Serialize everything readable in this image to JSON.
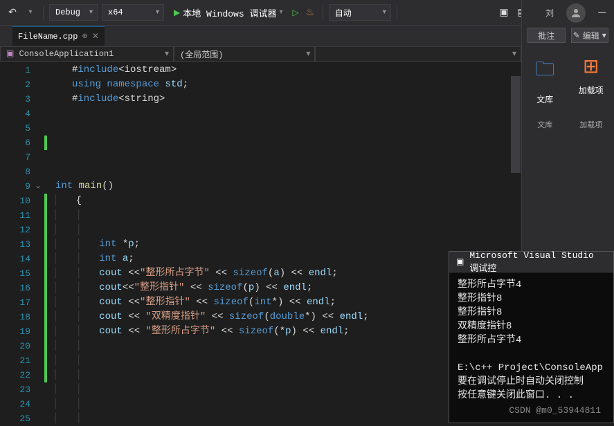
{
  "toolbar": {
    "config": "Debug",
    "platform": "x64",
    "debug_label": "本地 Windows 调试器",
    "auto_label": "自动"
  },
  "tab": {
    "filename": "FileName.cpp"
  },
  "scope": {
    "project": "ConsoleApplication1",
    "scope_label": "(全局范围)"
  },
  "editor": {
    "line_count": 25,
    "fold_line": 9,
    "lines": [
      {
        "n": 1,
        "diff": false,
        "html": "<span class='op'>#</span><span class='kw'>include</span><span class='punct'>&lt;</span><span class='plain'>iostream</span><span class='punct'>&gt;</span>"
      },
      {
        "n": 2,
        "diff": false,
        "html": "<span class='kw'>using</span> <span class='kw'>namespace</span> <span class='ident'>std</span><span class='punct'>;</span>"
      },
      {
        "n": 3,
        "diff": false,
        "html": "<span class='op'>#</span><span class='kw'>include</span><span class='punct'>&lt;</span><span class='plain'>string</span><span class='punct'>&gt;</span>"
      },
      {
        "n": 4,
        "diff": false,
        "html": ""
      },
      {
        "n": 5,
        "diff": false,
        "html": ""
      },
      {
        "n": 6,
        "diff": true,
        "html": ""
      },
      {
        "n": 7,
        "diff": false,
        "html": ""
      },
      {
        "n": 8,
        "diff": false,
        "html": ""
      },
      {
        "n": 9,
        "diff": false,
        "html": "<span class='type'>int</span> <span class='func'>main</span><span class='punct'>()</span>"
      },
      {
        "n": 10,
        "diff": true,
        "indent": 0,
        "html": "<span class='punct'>{</span>"
      },
      {
        "n": 11,
        "diff": true,
        "indent": 1,
        "html": ""
      },
      {
        "n": 12,
        "diff": true,
        "indent": 1,
        "html": ""
      },
      {
        "n": 13,
        "diff": true,
        "indent": 1,
        "html": "<span class='type'>int</span> <span class='op'>*</span><span class='ident'>p</span><span class='punct'>;</span>"
      },
      {
        "n": 14,
        "diff": true,
        "indent": 1,
        "html": "<span class='type'>int</span> <span class='ident'>a</span><span class='punct'>;</span>"
      },
      {
        "n": 15,
        "diff": true,
        "indent": 1,
        "html": "<span class='ident'>cout</span> <span class='op'>&lt;&lt;</span><span class='str'>\"整形所占字节\"</span> <span class='op'>&lt;&lt;</span> <span class='kw'>sizeof</span><span class='punct'>(</span><span class='ident'>a</span><span class='punct'>)</span> <span class='op'>&lt;&lt;</span> <span class='ident'>endl</span><span class='punct'>;</span>"
      },
      {
        "n": 16,
        "diff": true,
        "indent": 1,
        "html": "<span class='ident'>cout</span><span class='op'>&lt;&lt;</span><span class='str'>\"整形指针\"</span> <span class='op'>&lt;&lt;</span> <span class='kw'>sizeof</span><span class='punct'>(</span><span class='ident'>p</span><span class='punct'>)</span> <span class='op'>&lt;&lt;</span> <span class='ident'>endl</span><span class='punct'>;</span>"
      },
      {
        "n": 17,
        "diff": true,
        "indent": 1,
        "html": "<span class='ident'>cout</span> <span class='op'>&lt;&lt;</span><span class='str'>\"整形指针\"</span> <span class='op'>&lt;&lt;</span> <span class='kw'>sizeof</span><span class='punct'>(</span><span class='type'>int</span><span class='op'>*</span><span class='punct'>)</span> <span class='op'>&lt;&lt;</span> <span class='ident'>endl</span><span class='punct'>;</span>"
      },
      {
        "n": 18,
        "diff": true,
        "indent": 1,
        "html": "<span class='ident'>cout</span> <span class='op'>&lt;&lt;</span> <span class='str'>\"双精度指针\"</span> <span class='op'>&lt;&lt;</span> <span class='kw'>sizeof</span><span class='punct'>(</span><span class='type'>double</span><span class='op'>*</span><span class='punct'>)</span> <span class='op'>&lt;&lt;</span> <span class='ident'>endl</span><span class='punct'>;</span>"
      },
      {
        "n": 19,
        "diff": true,
        "indent": 1,
        "html": "<span class='ident'>cout</span> <span class='op'>&lt;&lt;</span> <span class='str'>\"整形所占字节\"</span> <span class='op'>&lt;&lt;</span> <span class='kw'>sizeof</span><span class='punct'>(</span><span class='op'>*</span><span class='ident'>p</span><span class='punct'>)</span> <span class='op'>&lt;&lt;</span> <span class='ident'>endl</span><span class='punct'>;</span>"
      },
      {
        "n": 20,
        "diff": true,
        "indent": 1,
        "html": ""
      },
      {
        "n": 21,
        "diff": true,
        "indent": 1,
        "html": ""
      },
      {
        "n": 22,
        "diff": true,
        "indent": 1,
        "html": ""
      },
      {
        "n": 23,
        "diff": false,
        "indent": 1,
        "html": ""
      },
      {
        "n": 24,
        "diff": false,
        "indent": 1,
        "html": ""
      },
      {
        "n": 25,
        "diff": false,
        "indent": 1,
        "html": ""
      }
    ]
  },
  "right_panel": {
    "user_char": "刘",
    "annotate": "批注",
    "edit": "编辑",
    "tiles": [
      {
        "icon_color": "#4aa8ff",
        "label": "文库",
        "sub": "文库"
      },
      {
        "icon_color": "#ff7a3c",
        "label": "加载项",
        "sub": "加载项"
      }
    ]
  },
  "console": {
    "title": "Microsoft Visual Studio 调试控",
    "output": [
      "整形所占字节4",
      "整形指针8",
      "整形指针8",
      "双精度指针8",
      "整形所占字节4",
      "",
      "E:\\c++ Project\\ConsoleApp",
      "要在调试停止时自动关闭控制",
      "按任意键关闭此窗口. . ."
    ]
  },
  "watermark": "CSDN @m0_53944811"
}
